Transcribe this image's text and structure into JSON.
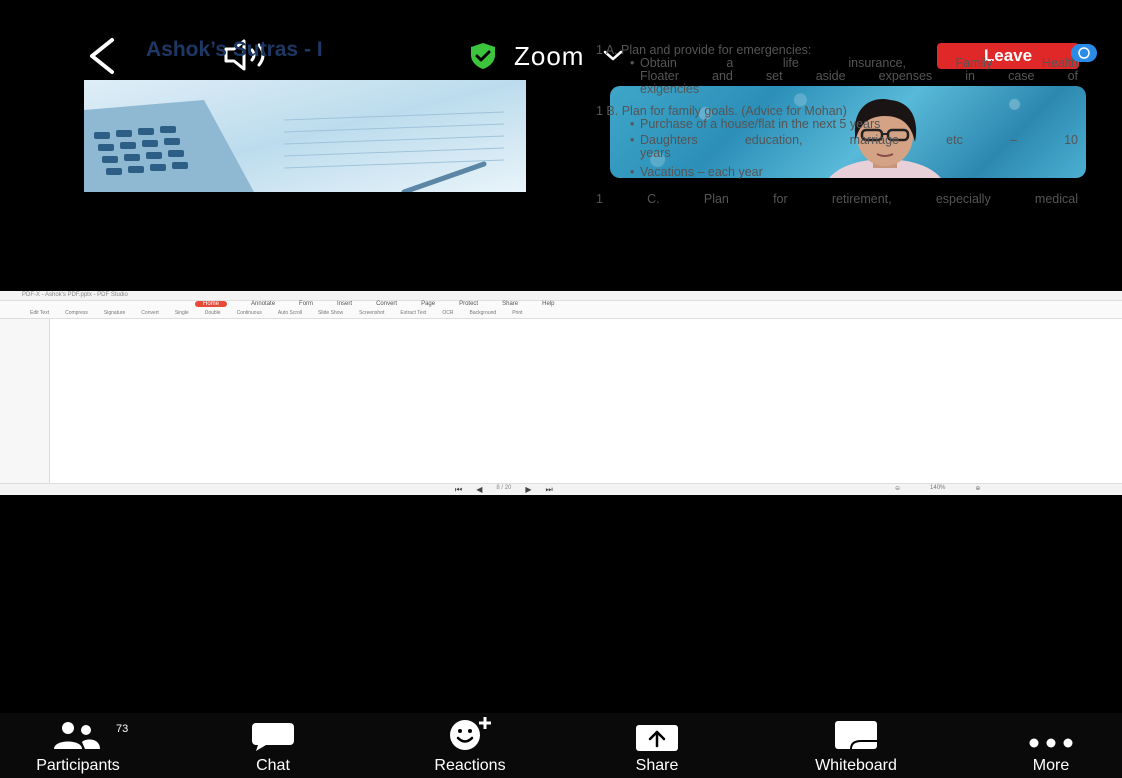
{
  "header": {
    "meeting_name": "Zoom",
    "leave_label": "Leave"
  },
  "shared_screen": {
    "window_title": "PDF-X - Ashok's PDF.pptx - PDF Studio",
    "ribbon_tabs": [
      "Home",
      "Annotate",
      "Form",
      "Insert",
      "Convert",
      "Page",
      "Protect",
      "Share",
      "Help"
    ],
    "ribbon_tools": [
      "Edit Text",
      "Compress",
      "Signature",
      "Convert",
      "Single",
      "Double",
      "Continuous",
      "Auto Scroll",
      "Slide Show",
      "Screenshot",
      "Extract Text",
      "OCR",
      "Background",
      "Print"
    ],
    "slide_title": "Ashok’s Sutras - I",
    "point_1a": "1 A. Plan and provide for emergencies:",
    "point_1a_b1_l1": "Obtain a life insurance, Family Health",
    "point_1a_b1_l2": "Floater and set aside expenses in case of",
    "point_1a_b1_l3": "exigencies",
    "point_1b": "1 B. Plan for family goals. (Advice for Mohan)",
    "point_1b_b1": "Purchase of a house/flat in the next 5 years",
    "point_1b_b2_l1": "Daughters education, marriage etc – 10",
    "point_1b_b2_l2": "years",
    "point_1b_b3": "Vacations – each year",
    "point_1c": "1 C. Plan for retirement, especially medical",
    "page_indicator": "8 / 20",
    "zoom_level": "140%"
  },
  "toolbar": {
    "participants_label": "Participants",
    "participants_count": "73",
    "chat_label": "Chat",
    "reactions_label": "Reactions",
    "share_label": "Share",
    "whiteboard_label": "Whiteboard",
    "more_label": "More"
  },
  "colors": {
    "leave": "#e02828",
    "shield": "#3cc43c",
    "slide_title": "#1d3864",
    "background": "#000000"
  }
}
